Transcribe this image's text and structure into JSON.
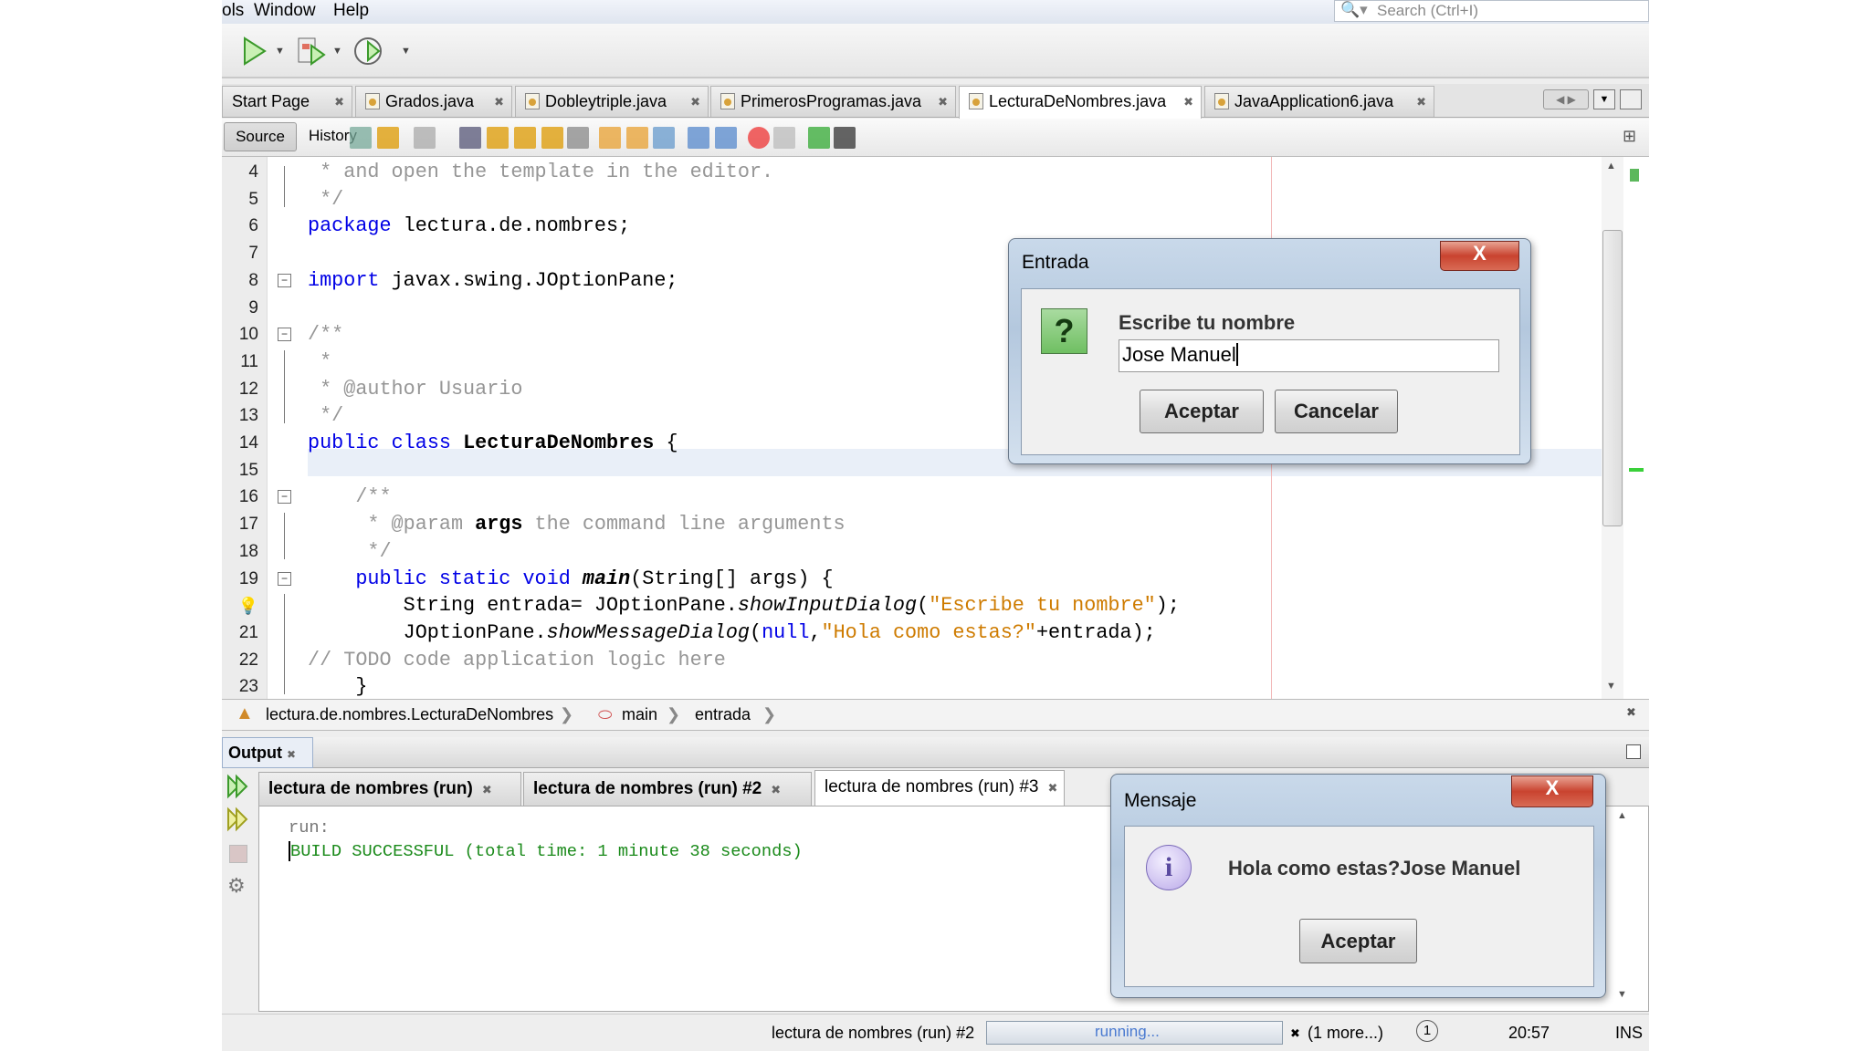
{
  "menu": {
    "items": [
      "ols",
      "Window",
      "Help"
    ],
    "search_placeholder": "Search (Ctrl+I)"
  },
  "editor_tabs": [
    {
      "label": "Start Page",
      "active": false
    },
    {
      "label": "Grados.java",
      "active": false
    },
    {
      "label": "Dobleytriple.java",
      "active": false
    },
    {
      "label": "PrimerosProgramas.java",
      "active": false
    },
    {
      "label": "LecturaDeNombres.java",
      "active": true
    },
    {
      "label": "JavaApplication6.java",
      "active": false
    }
  ],
  "editor_toolbar": {
    "source": "Source",
    "history": "History"
  },
  "code": {
    "lines": [
      {
        "n": "4",
        "tokens": [
          {
            "t": " * and open the template in the editor.",
            "c": "cm"
          }
        ]
      },
      {
        "n": "5",
        "tokens": [
          {
            "t": " */",
            "c": "cm"
          }
        ]
      },
      {
        "n": "6",
        "tokens": [
          {
            "t": "package",
            "c": "kw"
          },
          {
            "t": " lectura.de.nombres;",
            "c": ""
          }
        ]
      },
      {
        "n": "7",
        "tokens": []
      },
      {
        "n": "8",
        "tokens": [
          {
            "t": "import",
            "c": "kw"
          },
          {
            "t": " javax.swing.JOptionPane;",
            "c": ""
          }
        ]
      },
      {
        "n": "9",
        "tokens": []
      },
      {
        "n": "10",
        "tokens": [
          {
            "t": "/**",
            "c": "cm"
          }
        ]
      },
      {
        "n": "11",
        "tokens": [
          {
            "t": " *",
            "c": "cm"
          }
        ]
      },
      {
        "n": "12",
        "tokens": [
          {
            "t": " * @author Usuario",
            "c": "cm"
          }
        ]
      },
      {
        "n": "13",
        "tokens": [
          {
            "t": " */",
            "c": "cm"
          }
        ]
      },
      {
        "n": "14",
        "tokens": [
          {
            "t": "public",
            "c": "kw"
          },
          {
            "t": " ",
            "c": ""
          },
          {
            "t": "class",
            "c": "kw"
          },
          {
            "t": " ",
            "c": ""
          },
          {
            "t": "LecturaDeNombres",
            "c": "b"
          },
          {
            "t": " {",
            "c": ""
          }
        ]
      },
      {
        "n": "15",
        "tokens": []
      },
      {
        "n": "16",
        "tokens": [
          {
            "t": "    /**",
            "c": "cm"
          }
        ]
      },
      {
        "n": "17",
        "tokens": [
          {
            "t": "     * @param ",
            "c": "cm"
          },
          {
            "t": "args",
            "c": "b"
          },
          {
            "t": " the command line arguments",
            "c": "cm"
          }
        ]
      },
      {
        "n": "18",
        "tokens": [
          {
            "t": "     */",
            "c": "cm"
          }
        ]
      },
      {
        "n": "19",
        "tokens": [
          {
            "t": "    ",
            "c": ""
          },
          {
            "t": "public static void",
            "c": "kw"
          },
          {
            "t": " ",
            "c": ""
          },
          {
            "t": "main",
            "c": "bi"
          },
          {
            "t": "(String[] args) {",
            "c": ""
          }
        ]
      },
      {
        "n": "",
        "tokens": [
          {
            "t": "        String entrada= JOptionPane.",
            "c": ""
          },
          {
            "t": "showInputDialog",
            "c": "i"
          },
          {
            "t": "(",
            "c": ""
          },
          {
            "t": "\"Escribe tu nombre\"",
            "c": "st"
          },
          {
            "t": ");",
            "c": ""
          }
        ]
      },
      {
        "n": "21",
        "tokens": [
          {
            "t": "        JOptionPane.",
            "c": ""
          },
          {
            "t": "showMessageDialog",
            "c": "i"
          },
          {
            "t": "(",
            "c": ""
          },
          {
            "t": "null",
            "c": "kw"
          },
          {
            "t": ",",
            "c": ""
          },
          {
            "t": "\"Hola como estas?\"",
            "c": "st"
          },
          {
            "t": "+entrada);",
            "c": ""
          }
        ]
      },
      {
        "n": "22",
        "tokens": [
          {
            "t": "// TODO code application logic here",
            "c": "cm"
          }
        ]
      },
      {
        "n": "23",
        "tokens": [
          {
            "t": "    }",
            "c": ""
          }
        ]
      }
    ]
  },
  "breadcrumb": {
    "class": "lectura.de.nombres.LecturaDeNombres",
    "method": "main",
    "variable": "entrada"
  },
  "output": {
    "title": "Output",
    "tabs": [
      {
        "label": "lectura de nombres (run)",
        "active": false
      },
      {
        "label": "lectura de nombres (run) #2",
        "active": false
      },
      {
        "label": "lectura de nombres (run) #3",
        "active": true
      }
    ],
    "lines": [
      "run:",
      "BUILD SUCCESSFUL (total time: 1 minute 38 seconds)"
    ]
  },
  "status": {
    "task": "lectura de nombres (run) #2",
    "progress_label": "running...",
    "more": "(1 more...)",
    "notifications": "1",
    "time": "20:57",
    "mode": "INS"
  },
  "input_dialog": {
    "title": "Entrada",
    "message": "Escribe tu nombre",
    "value": "Jose Manuel",
    "ok": "Aceptar",
    "cancel": "Cancelar",
    "close": "X"
  },
  "message_dialog": {
    "title": "Mensaje",
    "message": "Hola como estas?Jose Manuel",
    "ok": "Aceptar",
    "close": "X"
  },
  "colors": {
    "keyword": "#0000e6",
    "comment": "#969696",
    "string": "#ce7b00",
    "build_success": "#1a8a1a"
  }
}
